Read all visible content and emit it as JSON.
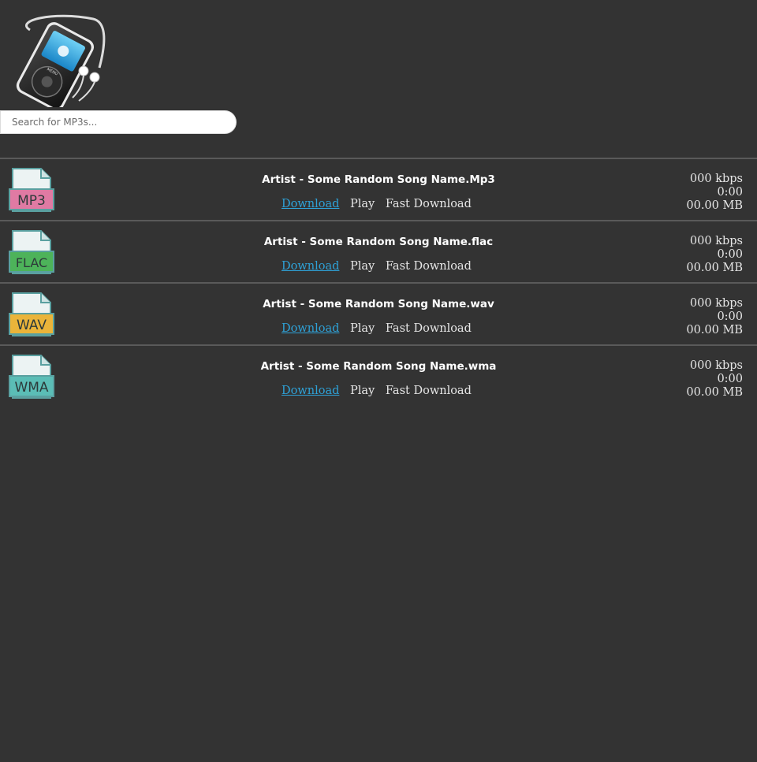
{
  "search": {
    "placeholder": "Search for MP3s..."
  },
  "files": [
    {
      "title": "Artist - Some Random Song Name.Mp3",
      "type_label": "MP3",
      "type_color": "#e07aa3",
      "download": "Download",
      "play": "Play",
      "fast_download": "Fast Download",
      "bitrate": "000 kbps",
      "duration": "0:00",
      "size": "00.00 MB"
    },
    {
      "title": "Artist - Some Random Song Name.flac",
      "type_label": "FLAC",
      "type_color": "#4db35a",
      "download": "Download",
      "play": "Play",
      "fast_download": "Fast Download",
      "bitrate": "000 kbps",
      "duration": "0:00",
      "size": "00.00 MB"
    },
    {
      "title": "Artist - Some Random Song Name.wav",
      "type_label": "WAV",
      "type_color": "#eab43a",
      "download": "Download",
      "play": "Play",
      "fast_download": "Fast Download",
      "bitrate": "000 kbps",
      "duration": "0:00",
      "size": "00.00 MB"
    },
    {
      "title": "Artist - Some Random Song Name.wma",
      "type_label": "WMA",
      "type_color": "#5bbdb6",
      "download": "Download",
      "play": "Play",
      "fast_download": "Fast Download",
      "bitrate": "000 kbps",
      "duration": "0:00",
      "size": "00.00 MB"
    }
  ],
  "colors": {
    "background": "#333333",
    "link": "#2ea2d8",
    "divider": "#5a5a5a"
  }
}
